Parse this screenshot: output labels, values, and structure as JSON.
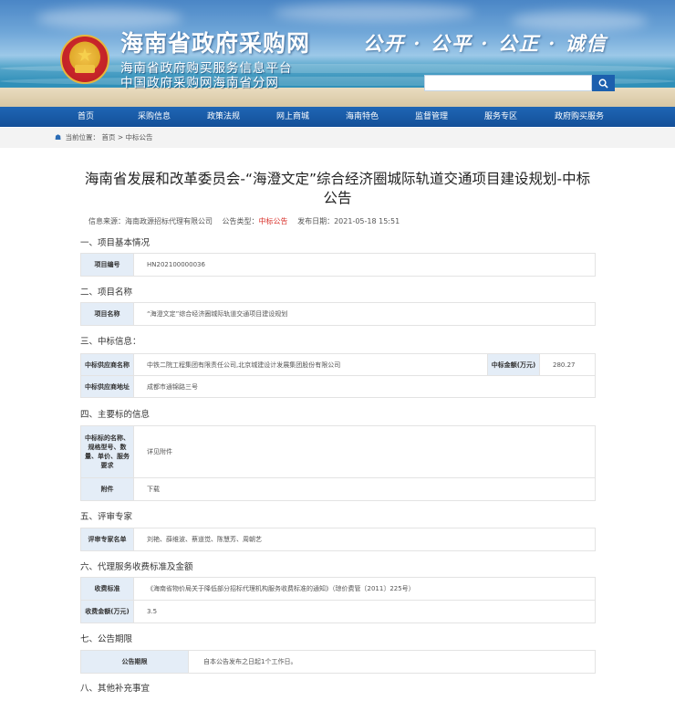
{
  "header": {
    "site_title": "海南省政府采购网",
    "subtitle_1": "海南省政府购买服务信息平台",
    "subtitle_2": "中国政府采购网海南省分网",
    "slogan": "公开 · 公平 · 公正 · 诚信",
    "search_value": "",
    "search_icon": "search-icon",
    "emblem": "national-emblem"
  },
  "nav": {
    "items": [
      "首页",
      "采购信息",
      "政策法规",
      "网上商城",
      "海南特色",
      "监督管理",
      "服务专区",
      "政府购买服务"
    ]
  },
  "breadcrumb": {
    "prefix": "当前位置：",
    "home": "首页",
    "sep": ">",
    "current": "中标公告"
  },
  "article": {
    "title": "海南省发展和改革委员会-“海澄文定”综合经济圈城际轨道交通项目建设规划-中标公告",
    "source_label": "信息来源：",
    "source": "海南政源招标代理有限公司",
    "type_label": "公告类型：",
    "type": "中标公告",
    "date_label": "发布日期：",
    "date": "2021-05-18 15:51"
  },
  "sections": {
    "s1": {
      "heading": "一、项目基本情况",
      "label": "项目编号",
      "value": "HN202100000036"
    },
    "s2": {
      "heading": "二、项目名称",
      "label": "项目名称",
      "value": "“海澄文定”综合经济圈城际轨道交通项目建设规划"
    },
    "s3": {
      "heading": "三、中标信息：",
      "supplier_label": "中标供应商名称",
      "supplier": "中铁二院工程集团有限责任公司,北京城建设计发展集团股份有限公司",
      "amount_label": "中标金额(万元)",
      "amount": "280.27",
      "address_label": "中标供应商地址",
      "address": "成都市通锦路三号"
    },
    "s4": {
      "heading": "四、主要标的信息",
      "item_label": "中标标的名称、规格型号、数量、单价、服务要求",
      "item_value": "详见附件",
      "attach_label": "附件",
      "attach_value": "下载"
    },
    "s5": {
      "heading": "五、评审专家",
      "label": "评审专家名单",
      "value": "刘艳、薛维波、蔡道觉、陈慧芳、周朝艺"
    },
    "s6": {
      "heading": "六、代理服务收费标准及金额",
      "std_label": "收费标准",
      "std_value": "《海南省物价局关于降低部分招标代理机构服务收费标准的通知》（琼价费管〔2011〕225号）",
      "fee_label": "收费金额(万元)",
      "fee_value": "3.5"
    },
    "s7": {
      "heading": "七、公告期限",
      "label": "公告期限",
      "value": "自本公告发布之日起1个工作日。"
    },
    "s8": {
      "heading": "八、其他补充事宜"
    }
  },
  "colors": {
    "nav_bg": "#1a5ba8",
    "label_bg": "#e4edf7",
    "accent_red": "#d9322b"
  }
}
